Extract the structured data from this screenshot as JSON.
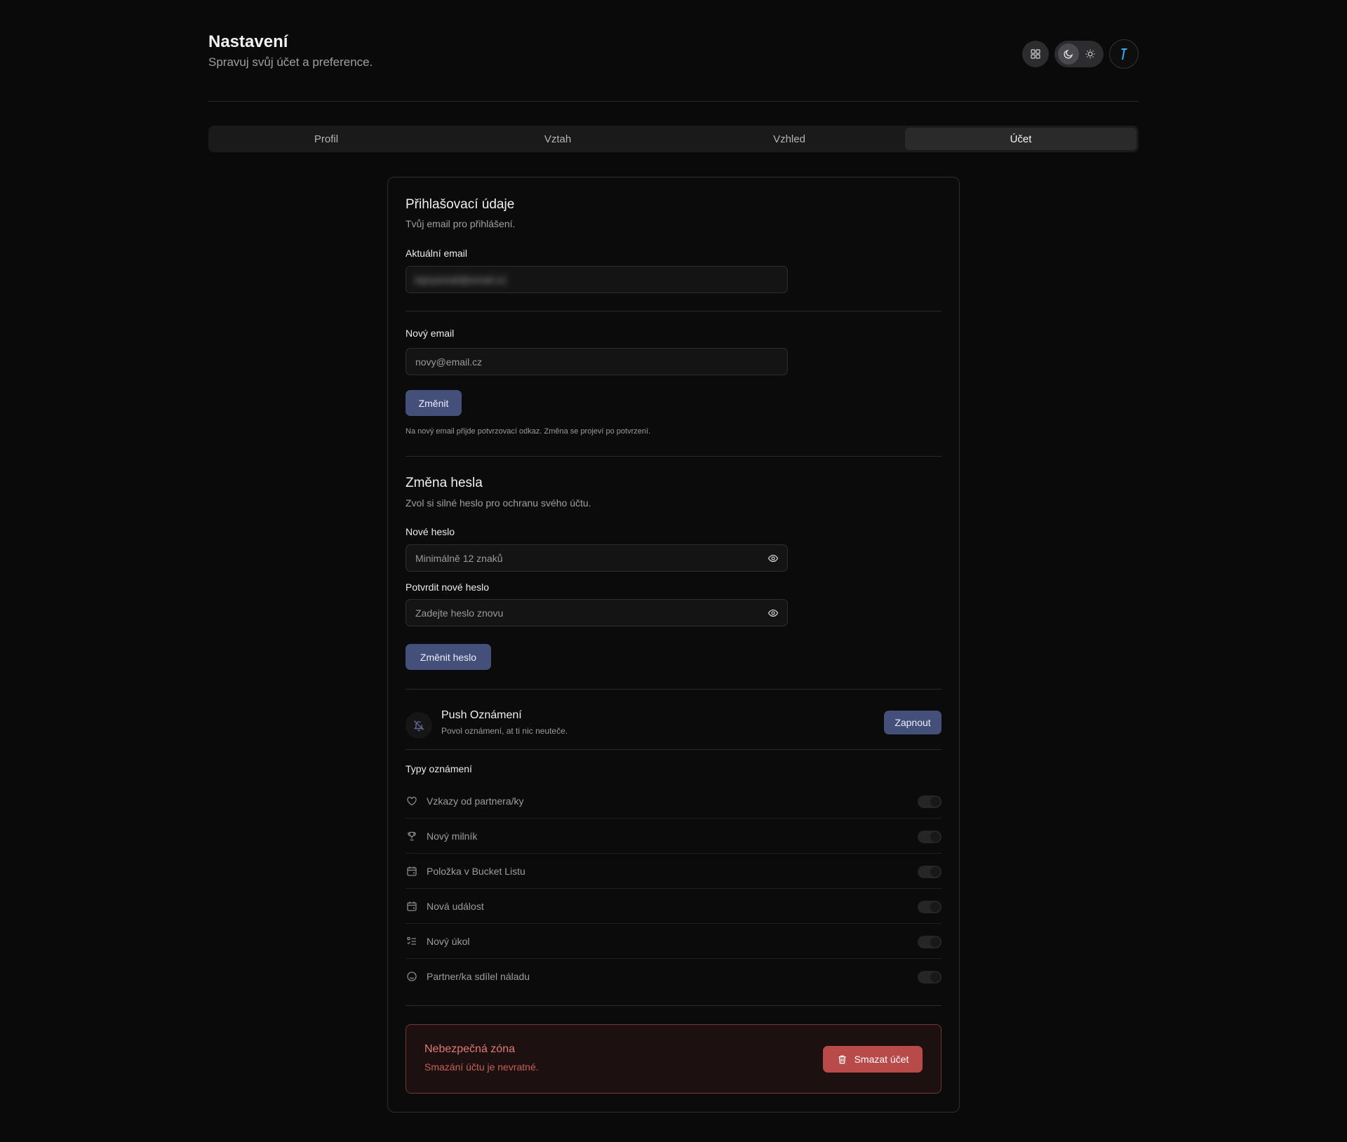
{
  "header": {
    "title": "Nastavení",
    "subtitle": "Spravuj svůj účet a preference.",
    "icons": [
      "grid-icon",
      "moon-icon",
      "sun-icon",
      "user-avatar-icon"
    ]
  },
  "tabs": [
    "Profil",
    "Vztah",
    "Vzhled",
    "Účet"
  ],
  "active_tab": "Účet",
  "login": {
    "title": "Přihlašovací údaje",
    "desc": "Tvůj email pro přihlášení.",
    "current_label": "Aktuální email",
    "current_value": "tajnyemail@email.cz",
    "new_label": "Nový email",
    "new_placeholder": "novy@email.cz",
    "change_button": "Změnit",
    "hint": "Na nový email přijde potvrzovací odkaz. Změna se projeví po potvrzení."
  },
  "password": {
    "title": "Změna hesla",
    "desc": "Zvol si silné heslo pro ochranu svého účtu.",
    "new_label": "Nové heslo",
    "new_placeholder": "Minimálně 12 znaků",
    "confirm_label": "Potvrdit nové heslo",
    "confirm_placeholder": "Zadejte heslo znovu",
    "button": "Změnit heslo"
  },
  "push": {
    "title": "Push Oznámení",
    "desc": "Povol oznámení, at ti nic neuteče.",
    "button": "Zapnout"
  },
  "notif_types": {
    "title": "Typy oznámení",
    "items": [
      {
        "label": "Vzkazy od partnera/ky",
        "icon": "heart-icon",
        "enabled": false
      },
      {
        "label": "Nový milník",
        "icon": "trophy-icon",
        "enabled": false
      },
      {
        "label": "Položka v Bucket Listu",
        "icon": "calendar-icon",
        "enabled": false
      },
      {
        "label": "Nová událost",
        "icon": "calendar-icon",
        "enabled": false
      },
      {
        "label": "Nový úkol",
        "icon": "checklist-icon",
        "enabled": false
      },
      {
        "label": "Partner/ka sdílel náladu",
        "icon": "smile-icon",
        "enabled": false
      }
    ]
  },
  "danger": {
    "title": "Nebezpečná zóna",
    "desc": "Smazání účtu je nevratné.",
    "button": "Smazat účet"
  },
  "colors": {
    "background": "#0a0a0a",
    "primary_button": "#44507a",
    "danger": "#b94a4a",
    "danger_text": "#e07a74"
  }
}
